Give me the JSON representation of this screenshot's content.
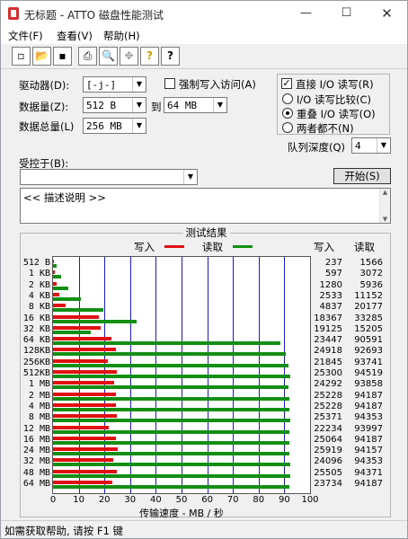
{
  "window": {
    "title": "无标题 - ATTO 磁盘性能测试",
    "min": "—",
    "max": "☐",
    "close": "✕"
  },
  "menu": [
    "文件(F)",
    "查看(V)",
    "帮助(H)"
  ],
  "toolbar": [
    "new",
    "open",
    "save",
    "print",
    "print-preview",
    "move",
    "help",
    "context-help"
  ],
  "toolbar_glyphs": [
    "▫",
    "📂",
    "▪",
    "⎙",
    "🔍",
    "✥",
    "?",
    "?"
  ],
  "controls": {
    "drive_label": "驱动器(D):",
    "drive_value": "[-j-]",
    "force_write_label": "强制写入访问(A)",
    "force_write_checked": false,
    "direct_io_label": "直接 I/O 读写(R)",
    "direct_io_checked": true,
    "data_size_label": "数据量(Z):",
    "data_size_from": "512 B",
    "to_label": "到",
    "data_size_to": "64 MB",
    "total_label": "数据总量(L)",
    "total_value": "256 MB",
    "io_compare_label": "I/O 读写比较(C)",
    "overlap_io_label": "重叠 I/O 读写(O)",
    "neither_label": "两者都不(N)",
    "selected_mode": "overlap",
    "queue_depth_label": "队列深度(Q)",
    "queue_depth_value": "4",
    "controlled_by_label": "受控于(B):",
    "controlled_by_value": "",
    "start_button": "开始(S)",
    "description_text": "<< 描述说明 >>"
  },
  "results": {
    "title": "测试结果",
    "write_legend": "写入",
    "read_legend": "读取",
    "write_header": "写入",
    "read_header": "读取",
    "xlabel": "传输速度 - MB / 秒"
  },
  "colors": {
    "write": "#e01010",
    "read": "#138f13",
    "grid": "#1a1acb"
  },
  "chart_data": {
    "type": "bar",
    "orientation": "horizontal",
    "categories": [
      "512 B",
      "1 KB",
      "2 KB",
      "4 KB",
      "8 KB",
      "16 KB",
      "32 KB",
      "64 KB",
      "128KB",
      "256KB",
      "512KB",
      "1 MB",
      "2 MB",
      "4 MB",
      "8 MB",
      "12 MB",
      "16 MB",
      "24 MB",
      "32 MB",
      "48 MB",
      "64 MB"
    ],
    "series": [
      {
        "name": "写入",
        "values": [
          237,
          597,
          1280,
          2533,
          4837,
          18367,
          19125,
          23447,
          24918,
          21845,
          25300,
          24292,
          25228,
          25228,
          25371,
          22234,
          25064,
          25919,
          24096,
          25505,
          23734
        ]
      },
      {
        "name": "读取",
        "values": [
          1566,
          3072,
          5936,
          11152,
          20177,
          33285,
          15205,
          90591,
          92693,
          93741,
          94519,
          93858,
          94187,
          94187,
          94353,
          93997,
          94187,
          94157,
          94353,
          94371,
          94187
        ]
      }
    ],
    "xlim": [
      0,
      100
    ],
    "xticks": [
      "0",
      "10",
      "20",
      "30",
      "40",
      "50",
      "60",
      "70",
      "80",
      "90",
      "100"
    ],
    "xlabel": "传输速度 - MB / 秒",
    "grid": true,
    "legend": "top"
  },
  "status": "如需获取帮助, 请按 F1 键"
}
